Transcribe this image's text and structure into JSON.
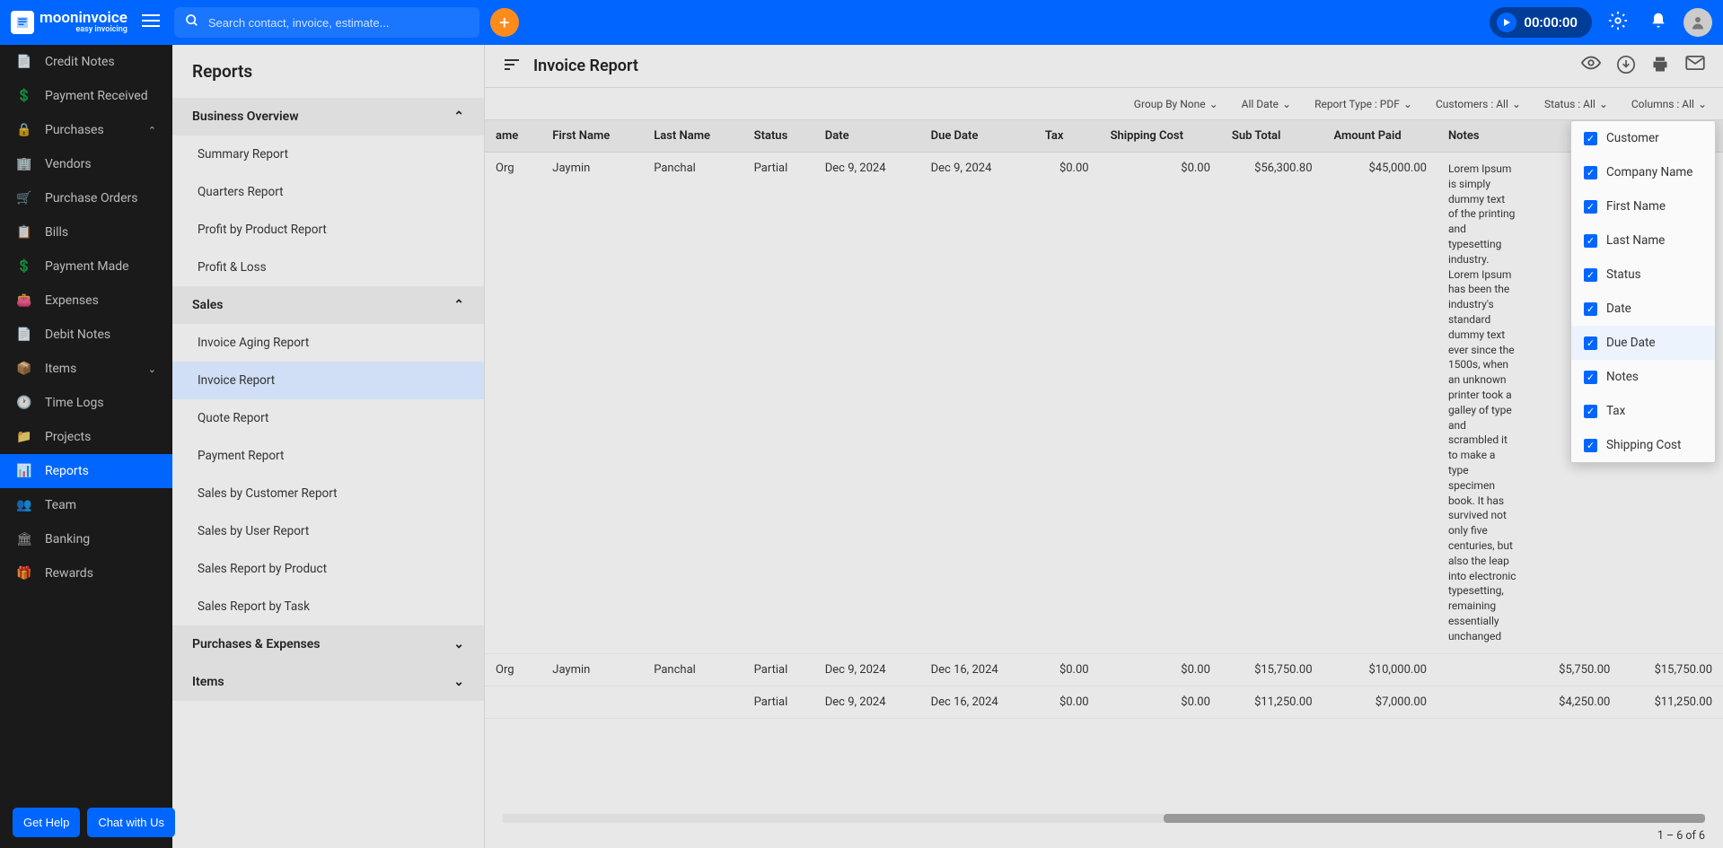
{
  "brand": {
    "name": "mooninvoice",
    "tagline": "easy invoicing"
  },
  "search": {
    "placeholder": "Search contact, invoice, estimate..."
  },
  "timer": {
    "value": "00:00:00"
  },
  "sidebar": {
    "items": [
      {
        "label": "Credit Notes",
        "icon": "📄"
      },
      {
        "label": "Payment Received",
        "icon": "💲"
      },
      {
        "label": "Purchases",
        "icon": "🔒",
        "expandable": true,
        "expanded": true
      },
      {
        "label": "Vendors",
        "icon": "🏢"
      },
      {
        "label": "Purchase Orders",
        "icon": "🛒"
      },
      {
        "label": "Bills",
        "icon": "📋"
      },
      {
        "label": "Payment Made",
        "icon": "💲"
      },
      {
        "label": "Expenses",
        "icon": "👛"
      },
      {
        "label": "Debit Notes",
        "icon": "📄"
      },
      {
        "label": "Items",
        "icon": "📦",
        "expandable": true
      },
      {
        "label": "Time Logs",
        "icon": "🕐"
      },
      {
        "label": "Projects",
        "icon": "📁"
      },
      {
        "label": "Reports",
        "icon": "📊",
        "active": true
      },
      {
        "label": "Team",
        "icon": "👥"
      },
      {
        "label": "Banking",
        "icon": "🏛"
      },
      {
        "label": "Rewards",
        "icon": "🎁"
      }
    ]
  },
  "buttons": {
    "help": "Get Help",
    "chat": "Chat with Us"
  },
  "panel": {
    "title": "Reports",
    "groups": [
      {
        "name": "Business Overview",
        "expanded": true,
        "items": [
          "Summary Report",
          "Quarters Report",
          "Profit by Product Report",
          "Profit & Loss"
        ]
      },
      {
        "name": "Sales",
        "expanded": true,
        "items": [
          "Invoice Aging Report",
          "Invoice Report",
          "Quote Report",
          "Payment Report",
          "Sales by Customer Report",
          "Sales by User Report",
          "Sales Report by Product",
          "Sales Report by Task"
        ],
        "active": "Invoice Report"
      },
      {
        "name": "Purchases & Expenses",
        "expanded": false
      },
      {
        "name": "Items",
        "expanded": false
      }
    ]
  },
  "main": {
    "title": "Invoice Report",
    "filters": {
      "group": "Group By None",
      "date": "All Date",
      "type": "Report Type : PDF",
      "customers": "Customers : All",
      "status": "Status : All",
      "columns": "Columns : All"
    },
    "columns_popover": [
      "Customer",
      "Company Name",
      "First Name",
      "Last Name",
      "Status",
      "Date",
      "Due Date",
      "Notes",
      "Tax",
      "Shipping Cost"
    ],
    "hover_col": "Due Date",
    "table": {
      "headers": [
        "ame",
        "First Name",
        "Last Name",
        "Status",
        "Date",
        "Due Date",
        "Tax",
        "Shipping Cost",
        "Sub Total",
        "Amount Paid",
        "Notes"
      ],
      "rows": [
        {
          "org": "Org",
          "first": "Jaymin",
          "last": "Panchal",
          "status": "Partial",
          "date": "Dec 9, 2024",
          "due": "Dec 9, 2024",
          "tax": "$0.00",
          "ship": "$0.00",
          "sub": "$56,300.80",
          "paid": "$45,000.00",
          "notes": "Lorem Ipsum is simply dummy text of the printing and typesetting industry. Lorem Ipsum has been the industry's standard dummy text ever since the 1500s, when an unknown printer took a galley of type and scrambled it to make a type specimen book. It has survived not only five centuries, but also the leap into electronic typesetting, remaining essentially unchanged"
        },
        {
          "org": "Org",
          "first": "Jaymin",
          "last": "Panchal",
          "status": "Partial",
          "date": "Dec 9, 2024",
          "due": "Dec 16, 2024",
          "tax": "$0.00",
          "ship": "$0.00",
          "sub": "$15,750.00",
          "paid": "$10,000.00",
          "notes": "",
          "extra1": "$5,750.00",
          "extra2": "$15,750.00"
        },
        {
          "org": "",
          "first": "",
          "last": "",
          "status": "Partial",
          "date": "Dec 9, 2024",
          "due": "Dec 16, 2024",
          "tax": "$0.00",
          "ship": "$0.00",
          "sub": "$11,250.00",
          "paid": "$7,000.00",
          "notes": "",
          "extra1": "$4,250.00",
          "extra2": "$11,250.00"
        }
      ]
    },
    "paging": "1 – 6 of 6"
  }
}
